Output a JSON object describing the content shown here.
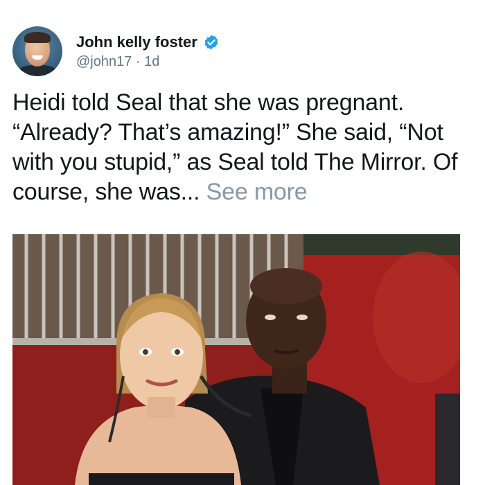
{
  "tweet": {
    "author_name": "John kelly foster",
    "handle": "@john17",
    "separator": " · ",
    "time": "1d",
    "text": "Heidi told Seal that she was pregnant. “Already? That’s amazing!” She said, “Not with you stupid,” as Seal told The Mirror. Of course, she was...",
    "see_more": "See more",
    "verified_color": "#1da1f2"
  },
  "icons": {
    "verified": "verified-badge-icon",
    "avatar": "profile-photo"
  }
}
